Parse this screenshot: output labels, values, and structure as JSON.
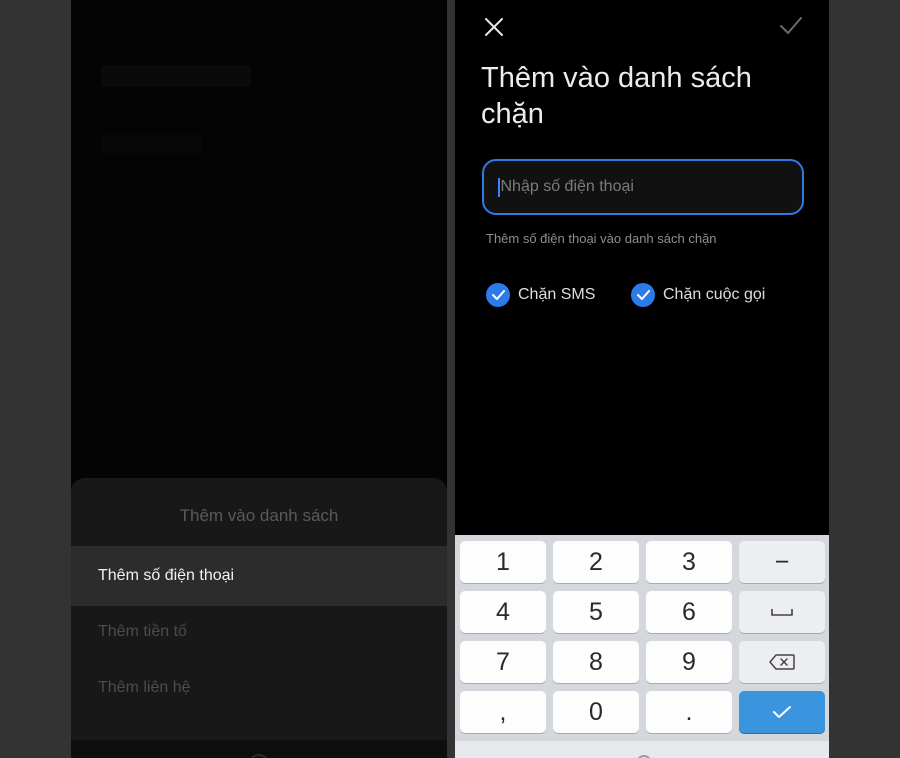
{
  "left_screen": {
    "sheet_title": "Thêm vào danh sách",
    "items": [
      {
        "label": "Thêm số điện thoại",
        "active": true
      },
      {
        "label": "Thêm tiền tố",
        "active": false
      },
      {
        "label": "Thêm liên hệ",
        "active": false
      }
    ]
  },
  "right_screen": {
    "close_icon": "close-icon",
    "confirm_icon": "checkmark-icon",
    "title": "Thêm vào danh sách chặn",
    "input": {
      "value": "",
      "placeholder": "Nhập số điện thoại"
    },
    "hint": "Thêm số điện thoại vào danh sách chặn",
    "checkboxes": [
      {
        "label": "Chặn SMS",
        "checked": true
      },
      {
        "label": "Chặn cuộc gọi",
        "checked": true
      }
    ],
    "accent_color": "#2c7bea"
  },
  "keypad": {
    "rows": [
      [
        "1",
        "2",
        "3",
        "−"
      ],
      [
        "4",
        "5",
        "6",
        "space-icon"
      ],
      [
        "7",
        "8",
        "9",
        "backspace-icon"
      ],
      [
        ",",
        "0",
        ".",
        "done-check-icon"
      ]
    ],
    "digit_keys": {
      "k1": "1",
      "k2": "2",
      "k3": "3",
      "dash": "−",
      "k4": "4",
      "k5": "5",
      "k6": "6",
      "k7": "7",
      "k8": "8",
      "k9": "9",
      "comma": ",",
      "k0": "0",
      "dot": "."
    }
  }
}
